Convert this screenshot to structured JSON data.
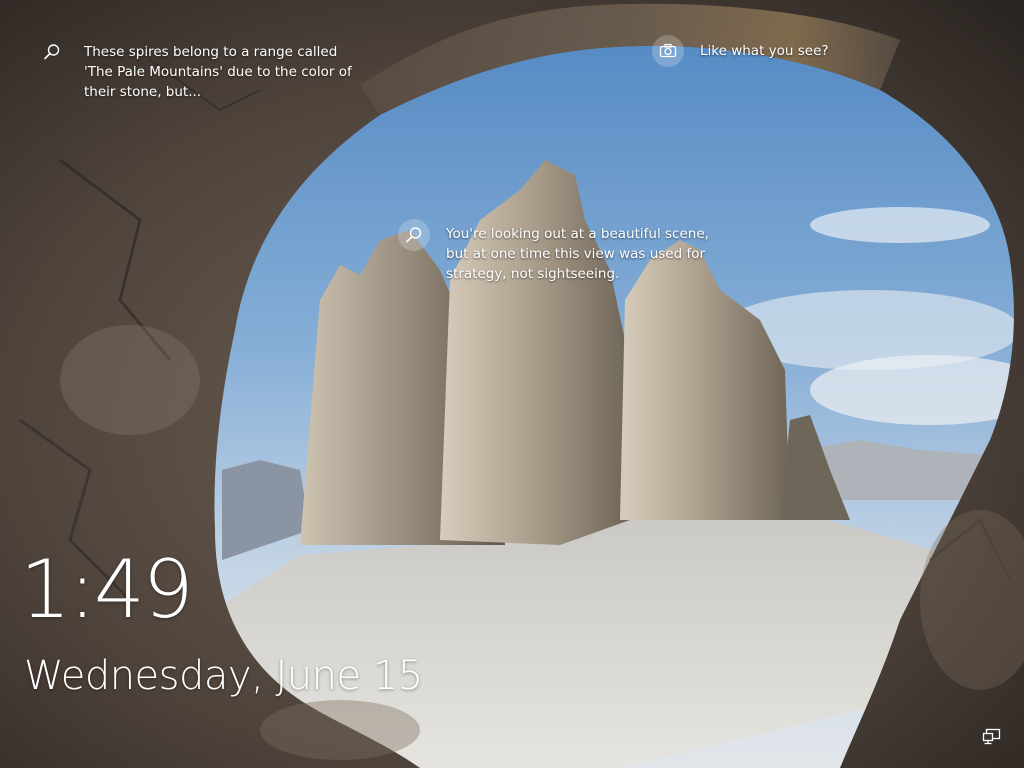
{
  "spotlight": {
    "fact_top": {
      "icon": "search-icon",
      "text": "These spires belong to a range called 'The Pale Mountains' due to the color of their stone, but..."
    },
    "fact_mid": {
      "icon": "search-icon",
      "text": "You're looking out at a beautiful scene, but at one time this view was used for strategy, not sightseeing."
    },
    "like_prompt": {
      "icon": "camera-icon",
      "text": "Like what you see?"
    }
  },
  "clock": {
    "time": "1:49",
    "date": "Wednesday, June 15"
  },
  "status": {
    "network_icon": "network-icon"
  },
  "colors": {
    "text": "#ffffff",
    "sky": "#7fa6d2",
    "rock": "#a89c8c",
    "cave": "#3d3530"
  }
}
